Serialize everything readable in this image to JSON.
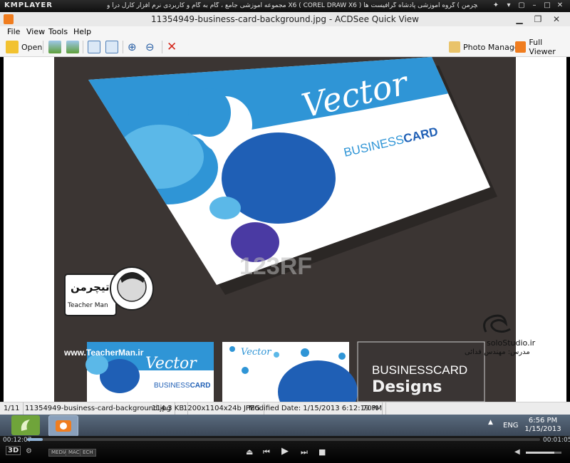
{
  "kmplayer": {
    "logo": "KMPLAYER",
    "title": "مجموعه آموزشی جامع ، گام به گام و کاربردی نرم افزار کارل درا و X6 ( COREL DRAW X6 )  مدرس : سعید فدایی (تیچرمن ) گروه آموزشی پادشاه گرافیست ها",
    "time_elapsed": "00:12:07",
    "time_total": "00:01:05",
    "pills": [
      "MEDIA",
      "MAC",
      "ECH"
    ],
    "progress": 0.03,
    "volume": 0.8
  },
  "window": {
    "title": "11354949-business-card-background.jpg - ACDSee Quick View"
  },
  "menu": [
    "File",
    "View",
    "Tools",
    "Help"
  ],
  "toolbar": {
    "open_label": "Open",
    "photo_manager_label": "Photo Manager",
    "full_viewer_label": "Full Viewer"
  },
  "image": {
    "vector_text": "Vector",
    "business_text": "BUSINESS",
    "card_text": "CARD",
    "watermark": "123RF",
    "thumb_vector": "Vector",
    "thumb_business": "BUSINESS",
    "thumb_card": "CARD",
    "thumb_designs": "Designs",
    "thumb_bc": "BUSINESSCARD",
    "teacher_site": "www.TeacherMan.ir",
    "teacher_name": "Teacher Man",
    "teacher_badge": "تیچرمن",
    "solo_site": "soloStudio.ir",
    "solo_credit": "مدرس: مهندس فدائی"
  },
  "status": {
    "index": "1/11",
    "filename": "11354949-business-card-background.jpg",
    "size": "114.3 KB",
    "dims": "1200x1104x24b JPEG",
    "modified": "Modified Date: 1/15/2013 6:12:19 PM",
    "zoom": "70%"
  },
  "taskbar": {
    "lang": "ENG",
    "time": "6:56 PM",
    "date": "1/15/2013"
  },
  "colors": {
    "card_blue": "#2f95d6",
    "dark_blue": "#1f5fb5",
    "purple": "#4a3aa3",
    "light_blue": "#5bb8e8",
    "bg": "#3b3533"
  }
}
